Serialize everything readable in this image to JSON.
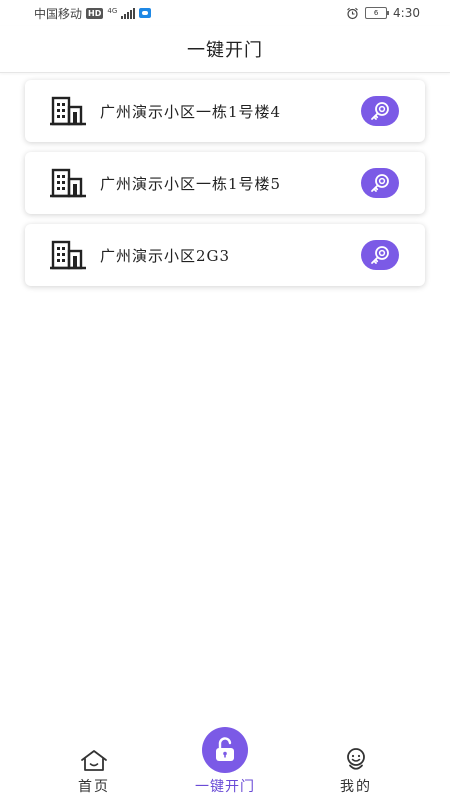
{
  "status_bar": {
    "carrier": "中国移动",
    "hd": "HD",
    "network": "4G",
    "battery": "6",
    "time": "4:30"
  },
  "header": {
    "title": "一键开门"
  },
  "doors": [
    {
      "label": "广州演示小区一栋1号楼4"
    },
    {
      "label": "广州演示小区一栋1号楼5"
    },
    {
      "label": "广州演示小区2G3"
    }
  ],
  "tabbar": {
    "home_label": "首页",
    "open_label": "一键开门",
    "mine_label": "我的"
  },
  "colors": {
    "accent": "#7b5ae6",
    "active_tab_text": "#6a4bd6"
  },
  "icons": {
    "door_item": "building-icon",
    "open_action": "key-icon",
    "home_tab": "home-icon",
    "open_tab": "unlock-icon",
    "mine_tab": "smiley-user-icon"
  }
}
